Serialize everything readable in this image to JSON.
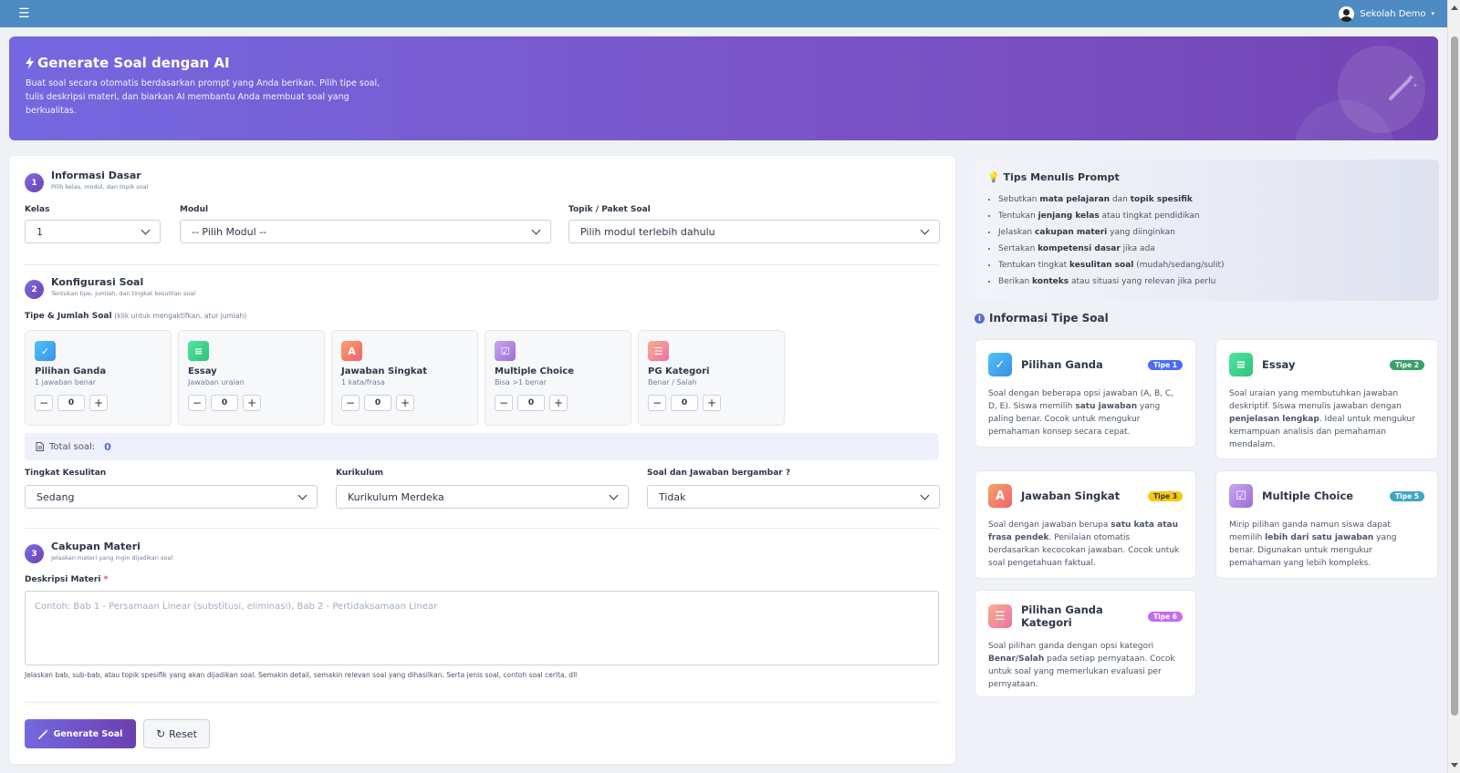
{
  "topbar": {
    "menu_icon": "hamburger-icon",
    "user_name": "Sekolah Demo",
    "user_caret": "▾"
  },
  "hero": {
    "title": "Generate Soal dengan AI",
    "description": "Buat soal secara otomatis berdasarkan prompt yang Anda berikan. Pilih tipe soal, tulis deskripsi materi, dan biarkan AI membantu Anda membuat soal yang berkualitas."
  },
  "section1": {
    "number": "1",
    "title": "Informasi Dasar",
    "subtitle": "Pilih kelas, modul, dan topik soal",
    "kelas_label": "Kelas",
    "kelas_value": "1",
    "modul_label": "Modul",
    "modul_value": "-- Pilih Modul --",
    "topik_label": "Topik / Paket Soal",
    "topik_value": "Pilih modul terlebih dahulu"
  },
  "section2": {
    "number": "2",
    "title": "Konfigurasi Soal",
    "subtitle": "Tentukan tipe, jumlah, dan tingkat kesulitan soal",
    "types_label": "Tipe & Jumlah Soal",
    "types_hint": "(klik untuk mengaktifkan, atur jumlah)",
    "types": [
      {
        "name": "Pilihan Ganda",
        "desc": "1 jawaban benar",
        "count": "0",
        "icon": "✓"
      },
      {
        "name": "Essay",
        "desc": "Jawaban uraian",
        "count": "0",
        "icon": "≡"
      },
      {
        "name": "Jawaban Singkat",
        "desc": "1 kata/frasa",
        "count": "0",
        "icon": "A"
      },
      {
        "name": "Multiple Choice",
        "desc": "Bisa >1 benar",
        "count": "0",
        "icon": "☑"
      },
      {
        "name": "PG Kategori",
        "desc": "Benar / Salah",
        "count": "0",
        "icon": "☰"
      }
    ],
    "minus": "−",
    "plus": "+",
    "total_label": "Total soal:",
    "total_value": "0",
    "kesulitan_label": "Tingkat Kesulitan",
    "kesulitan_value": "Sedang",
    "kurikulum_label": "Kurikulum",
    "kurikulum_value": "Kurikulum Merdeka",
    "gambar_label": "Soal dan Jawaban bergambar ?",
    "gambar_value": "Tidak"
  },
  "section3": {
    "number": "3",
    "title": "Cakupan Materi",
    "subtitle": "Jelaskan materi yang ingin dijadikan soal",
    "desc_label": "Deskripsi Materi",
    "required_mark": "*",
    "placeholder": "Contoh: Bab 1 - Persamaan Linear (substitusi, eliminasi), Bab 2 - Pertidaksamaan Linear",
    "help": "Jelaskan bab, sub-bab, atau topik spesifik yang akan dijadikan soal. Semakin detail, semakin relevan soal yang dihasilkan. Serta jenis soal, contoh soal cerita, dll"
  },
  "actions": {
    "generate": "Generate Soal",
    "reset": "Reset"
  },
  "tips": {
    "title": "Tips Menulis Prompt",
    "items": [
      [
        "Sebutkan ",
        "mata pelajaran",
        " dan ",
        "topik spesifik",
        ""
      ],
      [
        "Tentukan ",
        "jenjang kelas",
        " atau tingkat pendidikan",
        "",
        ""
      ],
      [
        "Jelaskan ",
        "cakupan materi",
        " yang diinginkan",
        "",
        ""
      ],
      [
        "Sertakan ",
        "kompetensi dasar",
        " jika ada",
        "",
        ""
      ],
      [
        "Tentukan tingkat ",
        "kesulitan soal",
        " (mudah/sedang/sulit)",
        "",
        ""
      ],
      [
        "Berikan ",
        "konteks",
        " atau situasi yang relevan jika perlu",
        "",
        ""
      ]
    ]
  },
  "info": {
    "title": "Informasi Tipe Soal",
    "cards": [
      {
        "name": "Pilihan Ganda",
        "badge": "Tipe 1",
        "icon": "✓",
        "p": [
          "Soal dengan beberapa opsi jawaban (A, B, C, D, E). Siswa memilih ",
          "satu jawaban",
          " yang paling benar. Cocok untuk mengukur pemahaman konsep secara cepat.",
          "",
          ""
        ]
      },
      {
        "name": "Essay",
        "badge": "Tipe 2",
        "icon": "≡",
        "p": [
          "Soal uraian yang membutuhkan jawaban deskriptif. Siswa menulis jawaban dengan ",
          "penjelasan lengkap",
          ". Ideal untuk mengukur kemampuan analisis dan pemahaman mendalam.",
          "",
          ""
        ]
      },
      {
        "name": "Jawaban Singkat",
        "badge": "Tipe 3",
        "icon": "A",
        "p": [
          "Soal dengan jawaban berupa ",
          "satu kata atau frasa pendek",
          ". Penilaian otomatis berdasarkan kecocokan jawaban. Cocok untuk soal pengetahuan faktual.",
          "",
          ""
        ]
      },
      {
        "name": "Multiple Choice",
        "badge": "Tipe 5",
        "icon": "☑",
        "p": [
          "Mirip pilihan ganda namun siswa dapat memilih ",
          "lebih dari satu jawaban",
          " yang benar. Digunakan untuk mengukur pemahaman yang lebih kompleks.",
          "",
          ""
        ]
      },
      {
        "name": "Pilihan Ganda Kategori",
        "badge": "Tipe 6",
        "icon": "☰",
        "p": [
          "Soal pilihan ganda dengan opsi kategori ",
          "Benar/Salah",
          " pada setiap pernyataan. Cocok untuk soal yang memerlukan evaluasi per pernyataan.",
          "",
          ""
        ]
      }
    ]
  },
  "colors": {
    "topbar": "#4d8bc2",
    "accent": "#7468e0",
    "pg": "#38b2f5",
    "essay": "#3dd68c",
    "singkat": "#f6866a",
    "mc": "#b08be0",
    "kategori": "#f08aa8",
    "badge1": "#4c6ef5",
    "badge2": "#38a169",
    "badge3": "#f6c90e",
    "badge5": "#3fa7c4",
    "badge6": "#c56cf0"
  }
}
